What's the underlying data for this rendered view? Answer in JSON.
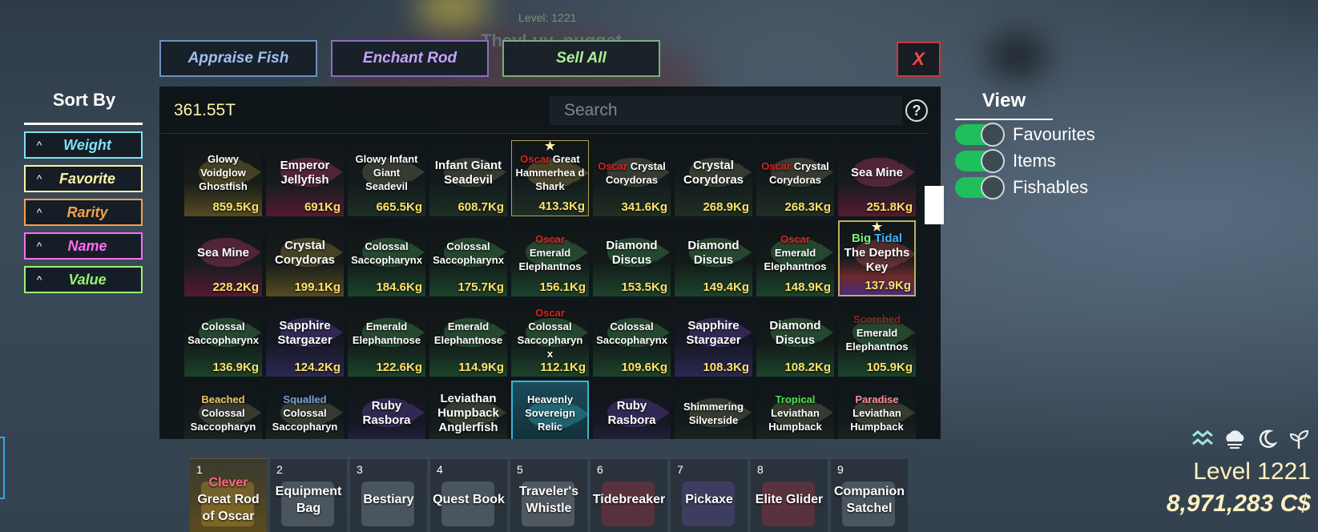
{
  "player": {
    "level_tag": "Level: 1221",
    "name": "TheyLuv_nugget"
  },
  "top_buttons": {
    "appraise": "Appraise Fish",
    "enchant": "Enchant Rod",
    "sell_all": "Sell All",
    "close": "X"
  },
  "sort": {
    "title": "Sort By",
    "items": [
      {
        "label": "Weight",
        "color": "#7fe3f5"
      },
      {
        "label": "Favorite",
        "color": "#fdf4a6"
      },
      {
        "label": "Rarity",
        "color": "#f5a24a"
      },
      {
        "label": "Name",
        "color": "#ff6cf0"
      },
      {
        "label": "Value",
        "color": "#9af078"
      }
    ]
  },
  "inventory": {
    "money": "361.55T",
    "search_placeholder": "Search",
    "help_icon": "?",
    "items": [
      {
        "prefix": "",
        "name": "Glowy Voidglow Ghostfish",
        "weight": "859.5Kg",
        "tint": "yellow",
        "small": true
      },
      {
        "prefix": "",
        "name": "Emperor Jellyfish",
        "weight": "691Kg",
        "tint": "pink"
      },
      {
        "prefix": "",
        "name": "Glowy Infant Giant Seadevil",
        "weight": "665.5Kg",
        "tint": "",
        "small": true
      },
      {
        "prefix": "",
        "name": "Infant Giant Seadevil",
        "weight": "608.7Kg",
        "tint": ""
      },
      {
        "prefix": "Oscar",
        "name": "Great Hammerhea d Shark",
        "weight": "413.3Kg",
        "tint": "gold",
        "star": true,
        "small": true
      },
      {
        "prefix": "Oscar",
        "name": "Crystal Corydoras",
        "weight": "341.6Kg",
        "tint": "",
        "small": true
      },
      {
        "prefix": "",
        "name": "Crystal Corydoras",
        "weight": "268.9Kg",
        "tint": ""
      },
      {
        "prefix": "Oscar",
        "name": "Crystal Corydoras",
        "weight": "268.3Kg",
        "tint": "",
        "small": true
      },
      {
        "prefix": "",
        "name": "Sea Mine",
        "weight": "251.8Kg",
        "tint": "pink"
      },
      {
        "prefix": "",
        "name": "Sea Mine",
        "weight": "228.2Kg",
        "tint": "pink"
      },
      {
        "prefix": "",
        "name": "Crystal Corydoras",
        "weight": "199.1Kg",
        "tint": "yellow"
      },
      {
        "prefix": "",
        "name": "Colossal Saccopharynx",
        "weight": "184.6Kg",
        "tint": "green",
        "small": true
      },
      {
        "prefix": "",
        "name": "Colossal Saccopharynx",
        "weight": "175.7Kg",
        "tint": "green",
        "small": true
      },
      {
        "prefix": "Oscar",
        "name": "Emerald Elephantnos",
        "weight": "156.1Kg",
        "tint": "green",
        "small": true
      },
      {
        "prefix": "",
        "name": "Diamond Discus",
        "weight": "153.5Kg",
        "tint": "green"
      },
      {
        "prefix": "",
        "name": "Diamond Discus",
        "weight": "149.4Kg",
        "tint": "green"
      },
      {
        "prefix": "Oscar",
        "name": "Emerald Elephantnos",
        "weight": "148.9Kg",
        "tint": "green",
        "small": true
      },
      {
        "prefix": "Big Tidal",
        "name": "The Depths Key",
        "weight": "137.9Kg",
        "tint": "rainbow",
        "star": true
      },
      {
        "prefix": "",
        "name": "Colossal Saccopharynx",
        "weight": "136.9Kg",
        "tint": "green",
        "small": true
      },
      {
        "prefix": "",
        "name": "Sapphire Stargazer",
        "weight": "124.2Kg",
        "tint": "purple"
      },
      {
        "prefix": "",
        "name": "Emerald Elephantnose",
        "weight": "122.6Kg",
        "tint": "green",
        "small": true
      },
      {
        "prefix": "",
        "name": "Emerald Elephantnose",
        "weight": "114.9Kg",
        "tint": "green",
        "small": true
      },
      {
        "prefix": "Oscar",
        "name": "Colossal Saccopharyn x",
        "weight": "112.1Kg",
        "tint": "green",
        "small": true
      },
      {
        "prefix": "",
        "name": "Colossal Saccopharynx",
        "weight": "109.6Kg",
        "tint": "green",
        "small": true
      },
      {
        "prefix": "",
        "name": "Sapphire Stargazer",
        "weight": "108.3Kg",
        "tint": "purple"
      },
      {
        "prefix": "",
        "name": "Diamond Discus",
        "weight": "108.2Kg",
        "tint": "green"
      },
      {
        "prefix": "Scorched",
        "name": "Emerald Elephantnos",
        "weight": "105.9Kg",
        "tint": "green",
        "small": true
      },
      {
        "prefix": "Beached",
        "name": "Colossal Saccopharyn",
        "weight": "",
        "tint": "",
        "small": true
      },
      {
        "prefix": "Squalled",
        "name": "Colossal Saccopharyn",
        "weight": "",
        "tint": "",
        "small": true
      },
      {
        "prefix": "",
        "name": "Ruby Rasbora",
        "weight": "",
        "tint": "purple"
      },
      {
        "prefix": "",
        "name": "Leviathan Humpback Anglerfish",
        "weight": "",
        "tint": ""
      },
      {
        "prefix": "",
        "name": "Heavenly Sovereign Relic",
        "weight": "",
        "tint": "teal",
        "small": true
      },
      {
        "prefix": "",
        "name": "Ruby Rasbora",
        "weight": "",
        "tint": "purple"
      },
      {
        "prefix": "",
        "name": "Shimmering Silverside",
        "weight": "",
        "tint": "",
        "small": true
      },
      {
        "prefix": "Tropical",
        "name": "Leviathan Humpback",
        "weight": "",
        "tint": "",
        "small": true
      },
      {
        "prefix": "Paradise",
        "name": "Leviathan Humpback",
        "weight": "",
        "tint": "",
        "small": true
      }
    ]
  },
  "view": {
    "title": "View",
    "toggles": [
      {
        "label": "Favourites",
        "on": true
      },
      {
        "label": "Items",
        "on": true
      },
      {
        "label": "Fishables",
        "on": true
      }
    ]
  },
  "hotbar": [
    {
      "num": "1",
      "prefix": "Clever",
      "label": "Great Rod of Oscar",
      "active": true,
      "icon": "rod-icon"
    },
    {
      "num": "2",
      "prefix": "",
      "label": "Equipment Bag",
      "icon": "bag-icon"
    },
    {
      "num": "3",
      "prefix": "",
      "label": "Bestiary",
      "icon": "book-icon"
    },
    {
      "num": "4",
      "prefix": "",
      "label": "Quest Book",
      "icon": "quest-book-icon"
    },
    {
      "num": "5",
      "prefix": "",
      "label": "Traveler's Whistle",
      "icon": "whistle-icon"
    },
    {
      "num": "6",
      "prefix": "",
      "label": "Tidebreaker",
      "icon": "crate-icon"
    },
    {
      "num": "7",
      "prefix": "",
      "label": "Pickaxe",
      "icon": "crate-icon"
    },
    {
      "num": "8",
      "prefix": "",
      "label": "Elite Glider",
      "icon": "crate-icon"
    },
    {
      "num": "9",
      "prefix": "",
      "label": "Companion Satchel",
      "icon": "satchel-icon"
    }
  ],
  "status": {
    "icons": [
      "waves-icon",
      "cloud-icon",
      "moon-icon",
      "sprout-icon"
    ],
    "level": "Level 1221",
    "cash": "8,971,283 C$"
  }
}
